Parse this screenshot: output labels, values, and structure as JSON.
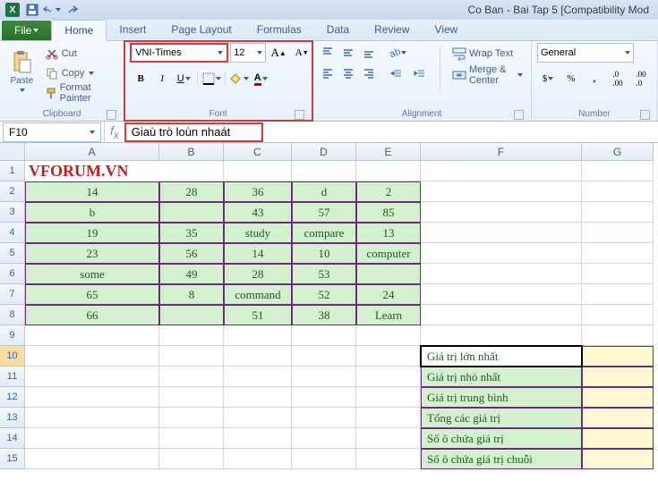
{
  "title": "Co Ban - Bai Tap 5  [Compatibility Mod",
  "tabs": {
    "file": "File",
    "items": [
      "Home",
      "Insert",
      "Page Layout",
      "Formulas",
      "Data",
      "Review",
      "View"
    ],
    "active": 0
  },
  "clipboard": {
    "paste": "Paste",
    "cut": "Cut",
    "copy": "Copy",
    "format_painter": "Format Painter",
    "group": "Clipboard"
  },
  "font": {
    "name": "VNI-Times",
    "size": "12",
    "bold": "B",
    "italic": "I",
    "underline": "U",
    "group": "Font"
  },
  "alignment": {
    "wrap": "Wrap Text",
    "merge": "Merge & Center",
    "group": "Alignment"
  },
  "number": {
    "format": "General",
    "group": "Number"
  },
  "formula_bar": {
    "name_box": "F10",
    "value": "Giaù trò loùn nhaát"
  },
  "columns": [
    "A",
    "B",
    "C",
    "D",
    "E",
    "F",
    "G"
  ],
  "rows": [
    "1",
    "2",
    "3",
    "4",
    "5",
    "6",
    "7",
    "8",
    "9",
    "10",
    "11",
    "12",
    "13",
    "14",
    "15"
  ],
  "grid": {
    "a1": "VFORUM.VN",
    "r2": {
      "a": "14",
      "b": "28",
      "c": "36",
      "d": "d",
      "e": "2"
    },
    "r3": {
      "a": "b",
      "b": "",
      "c": "43",
      "d": "57",
      "e": "85"
    },
    "r4": {
      "a": "19",
      "b": "35",
      "c": "study",
      "d": "compare",
      "e": "13"
    },
    "r5": {
      "a": "23",
      "b": "56",
      "c": "14",
      "d": "10",
      "e": "computer"
    },
    "r6": {
      "a": "some",
      "b": "49",
      "c": "28",
      "d": "53",
      "e": ""
    },
    "r7": {
      "a": "65",
      "b": "8",
      "c": "command",
      "d": "52",
      "e": "24"
    },
    "r8": {
      "a": "66",
      "b": "",
      "c": "51",
      "d": "38",
      "e": "Learn"
    }
  },
  "stats": {
    "f10": "Giá trị lớn nhất",
    "f11": "Giá trị nhỏ nhất",
    "f12": "Giá trị trung bình",
    "f13": "Tổng các giá trị",
    "f14": "Số ô chứa giá trị",
    "f15": "Số ô chứa giá trị chuỗi"
  }
}
